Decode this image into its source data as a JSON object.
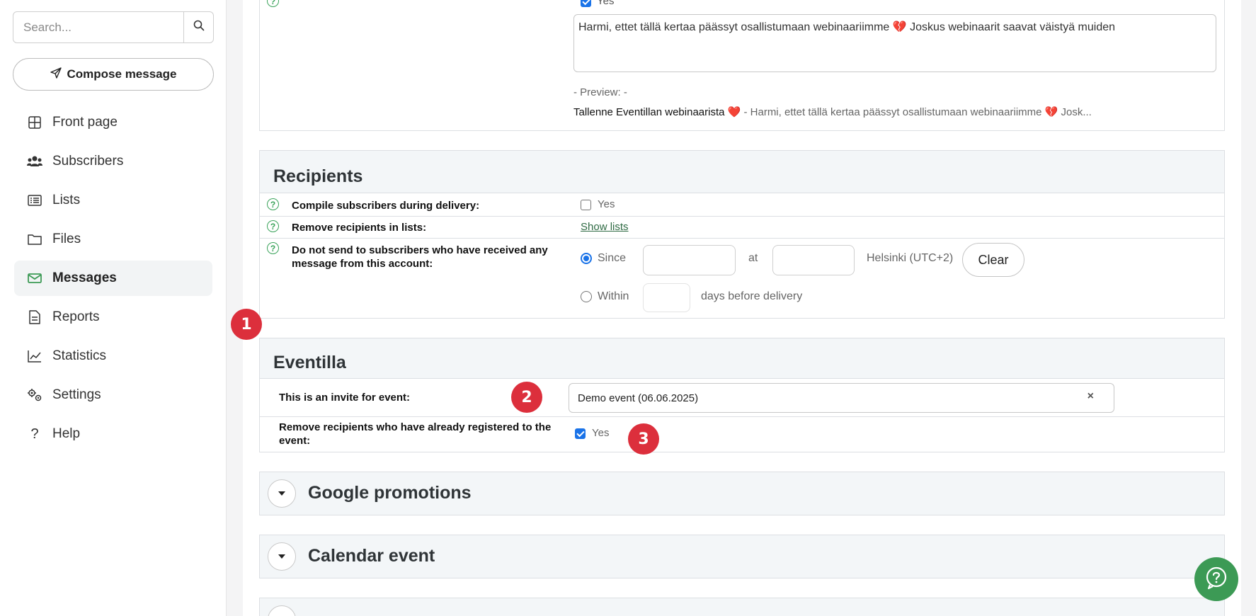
{
  "sidebar": {
    "search_placeholder": "Search...",
    "compose_label": "Compose message",
    "items": [
      {
        "label": "Front page",
        "icon": "grid-icon"
      },
      {
        "label": "Subscribers",
        "icon": "users-icon"
      },
      {
        "label": "Lists",
        "icon": "list-icon"
      },
      {
        "label": "Files",
        "icon": "folder-icon"
      },
      {
        "label": "Messages",
        "icon": "envelope-icon",
        "active": true
      },
      {
        "label": "Reports",
        "icon": "document-icon"
      },
      {
        "label": "Statistics",
        "icon": "chart-icon"
      },
      {
        "label": "Settings",
        "icon": "gears-icon"
      },
      {
        "label": "Help",
        "icon": "question-icon"
      }
    ]
  },
  "preheader": {
    "checkbox_label": "Yes",
    "textarea_value": "Harmi, ettet tällä kertaa päässyt osallistumaan webinaariimme 💔 Joskus webinaarit saavat väistyä muiden",
    "preview_label": "- Preview: -",
    "preview_subject": "Tallenne Eventillan webinaarista ❤️",
    "preview_text": "- Harmi, ettet tällä kertaa päässyt osallistumaan webinaariimme 💔 Josk..."
  },
  "recipients": {
    "title": "Recipients",
    "compile_label": "Compile subscribers during delivery:",
    "compile_value": "Yes",
    "remove_label": "Remove recipients in lists:",
    "show_lists": "Show lists",
    "donotsend_label": "Do not send to subscribers who have received any message from this account:",
    "since_label": "Since",
    "at_label": "at",
    "timezone": "Helsinki (UTC+2)",
    "clear_label": "Clear",
    "within_label": "Within",
    "days_label": "days before delivery"
  },
  "eventilla": {
    "title": "Eventilla",
    "invite_label": "This is an invite for event:",
    "invite_value": "Demo event (06.06.2025)",
    "remove_registered_label": "Remove recipients who have already registered to the event:",
    "remove_registered_value": "Yes"
  },
  "collapsed_sections": [
    "Google promotions",
    "Calendar event"
  ],
  "badges": [
    "1",
    "2",
    "3"
  ],
  "colors": {
    "accent_green": "#3c9a55",
    "badge_red": "#dc2f3c",
    "checkbox_blue": "#1a73e8"
  }
}
